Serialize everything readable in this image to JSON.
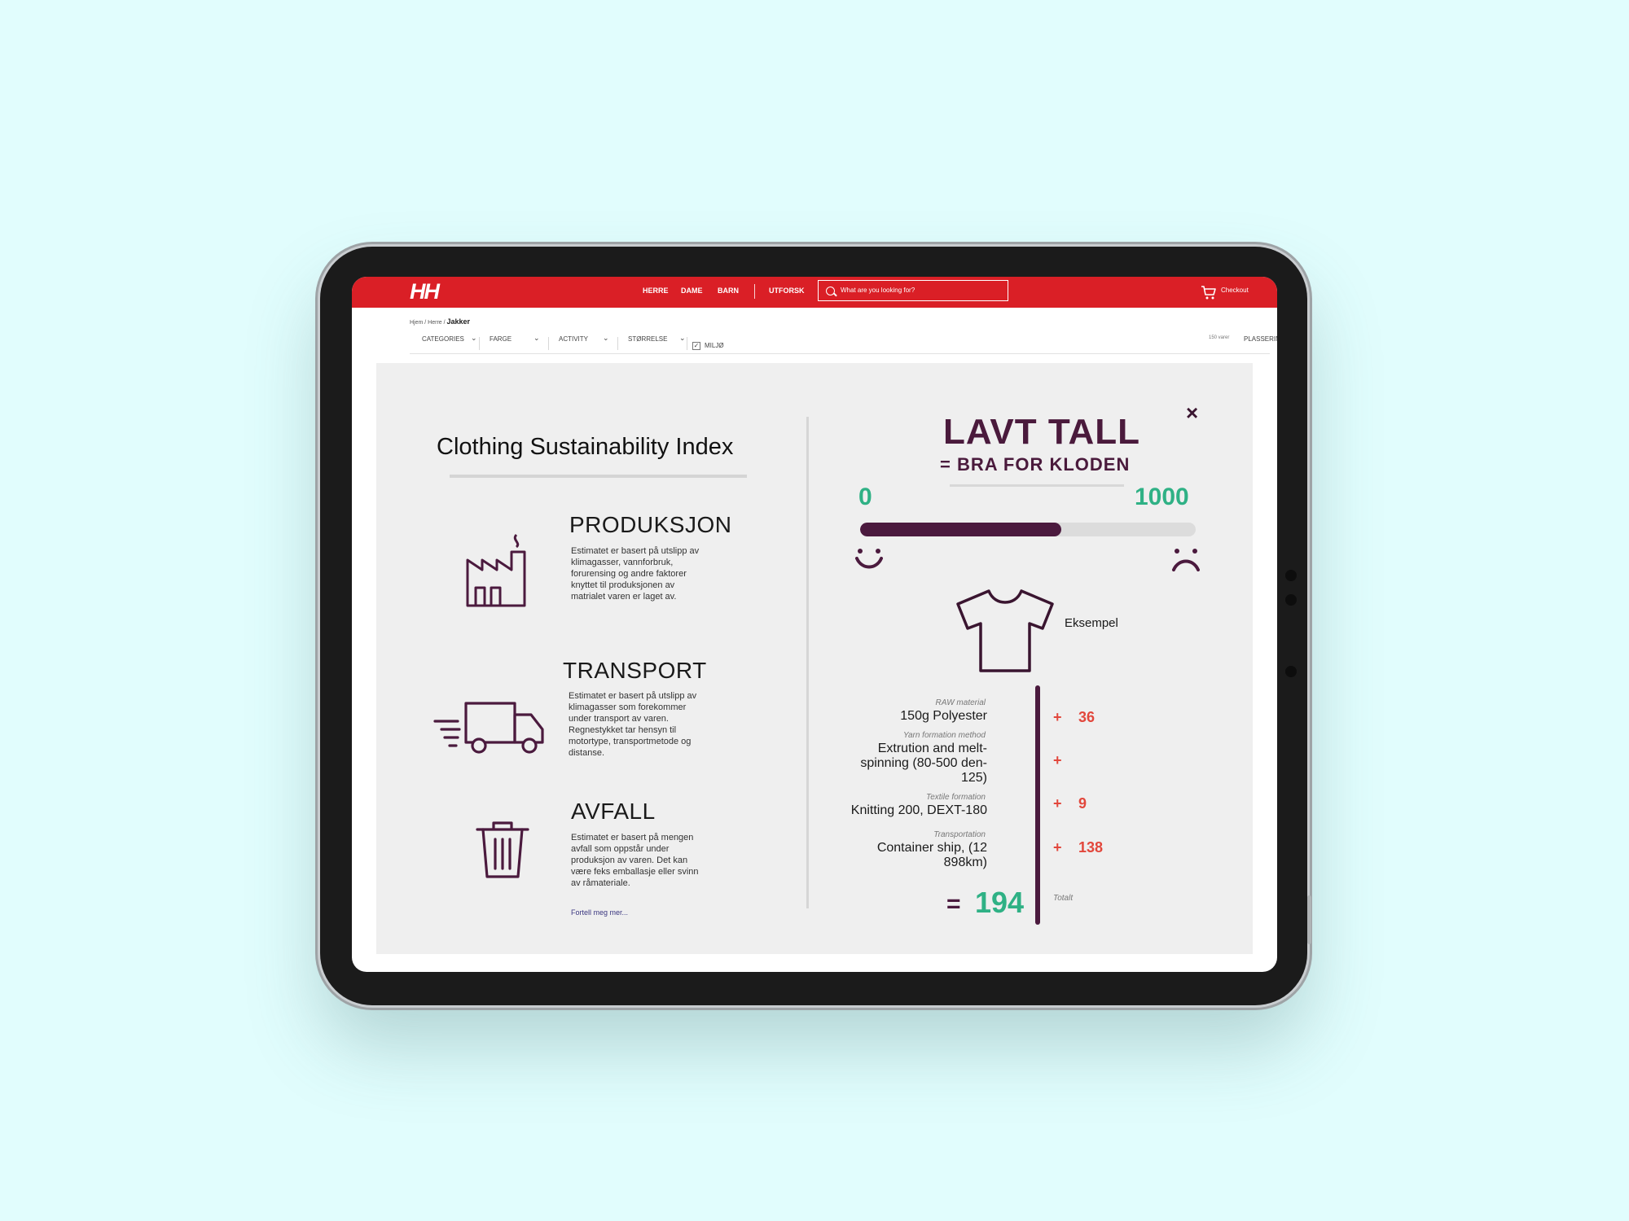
{
  "header": {
    "logo": "HH",
    "nav": [
      "HERRE",
      "DAME",
      "BARN",
      "UTFORSK"
    ],
    "search_placeholder": "What are you looking for?",
    "checkout": "Checkout"
  },
  "breadcrumb": {
    "path": "Hjem / Herre /",
    "current": "Jakker"
  },
  "filters": {
    "items": [
      "CATEGORIES",
      "FARGE",
      "ACTIVITY",
      "STØRRELSE"
    ],
    "miljo": "MILJØ",
    "count": "150 varer",
    "sort": "PLASSERING"
  },
  "index": {
    "title": "Clothing Sustainability Index",
    "sections": [
      {
        "heading": "PRODUKSJON",
        "text": "Estimatet er basert på utslipp av klimagasser, vannforbruk, forurensing og andre faktorer knyttet til produksjonen av matrialet varen er laget av."
      },
      {
        "heading": "TRANSPORT",
        "text": "Estimatet er basert på utslipp av klimagasser som forekommer under transport av varen. Regnestykket tar hensyn til motortype, transportmetode og distanse."
      },
      {
        "heading": "AVFALL",
        "text": "Estimatet er basert på mengen avfall som oppstår under produksjon av varen. Det kan være feks emballasje eller svinn av råmateriale."
      }
    ],
    "more_link": "Fortell meg mer..."
  },
  "score": {
    "headline": "LAVT TALL",
    "subheadline": "= BRA FOR KLODEN",
    "scale_min": "0",
    "scale_max": "1000",
    "fill_fraction": 0.6,
    "example_label": "Eksempel",
    "breakdown": [
      {
        "label": "RAW material",
        "value": "150g  Polyester",
        "points": "36"
      },
      {
        "label": "Yarn formation method",
        "value": "Extrution and melt-spinning (80-500 den-125)",
        "points": ""
      },
      {
        "label": "Textile formation",
        "value": "Knitting 200, DEXT-180",
        "points": "9"
      },
      {
        "label": "Transportation",
        "value": "Container ship, (12 898km)",
        "points": "138"
      }
    ],
    "plus": "+",
    "equals": "=",
    "total": "194",
    "total_label": "Totalt",
    "close": "×"
  },
  "colors": {
    "brand_red": "#da1f26",
    "plum": "#4b1a3e",
    "green": "#2fb185",
    "orange": "#e2473c"
  }
}
